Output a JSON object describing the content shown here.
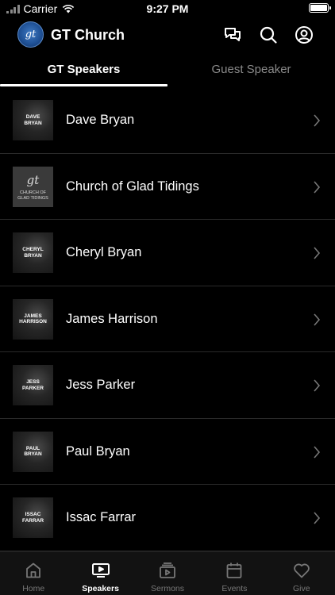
{
  "status_bar": {
    "carrier": "Carrier",
    "time": "9:27 PM"
  },
  "header": {
    "logo_text": "gt",
    "title": "GT Church",
    "icons": [
      "chat-icon",
      "search-icon",
      "profile-icon"
    ]
  },
  "tabs": [
    {
      "label": "GT Speakers",
      "active": true
    },
    {
      "label": "Guest Speaker",
      "active": false
    }
  ],
  "speakers": [
    {
      "name": "Dave Bryan",
      "thumb_lines": [
        "DAVE",
        "BRYAN"
      ]
    },
    {
      "name": "Church of Glad Tidings",
      "thumb_mark": "gt",
      "thumb_lines": [
        "CHURCH OF",
        "GLAD TIDINGS"
      ]
    },
    {
      "name": "Cheryl Bryan",
      "thumb_lines": [
        "CHERYL",
        "BRYAN"
      ]
    },
    {
      "name": "James Harrison",
      "thumb_lines": [
        "JAMES",
        "HARRISON"
      ]
    },
    {
      "name": "Jess Parker",
      "thumb_lines": [
        "JESS",
        "PARKER"
      ]
    },
    {
      "name": "Paul Bryan",
      "thumb_lines": [
        "PAUL",
        "BRYAN"
      ]
    },
    {
      "name": "Issac Farrar",
      "thumb_lines": [
        "ISSAC",
        "FARRAR"
      ]
    }
  ],
  "tab_bar": [
    {
      "label": "Home",
      "icon": "home-icon",
      "active": false
    },
    {
      "label": "Speakers",
      "icon": "speakers-icon",
      "active": true
    },
    {
      "label": "Sermons",
      "icon": "sermons-icon",
      "active": false
    },
    {
      "label": "Events",
      "icon": "events-icon",
      "active": false
    },
    {
      "label": "Give",
      "icon": "give-icon",
      "active": false
    }
  ],
  "colors": {
    "background": "#000000",
    "accent_logo": "#1e4f93",
    "inactive_text": "#8a8a8a"
  }
}
